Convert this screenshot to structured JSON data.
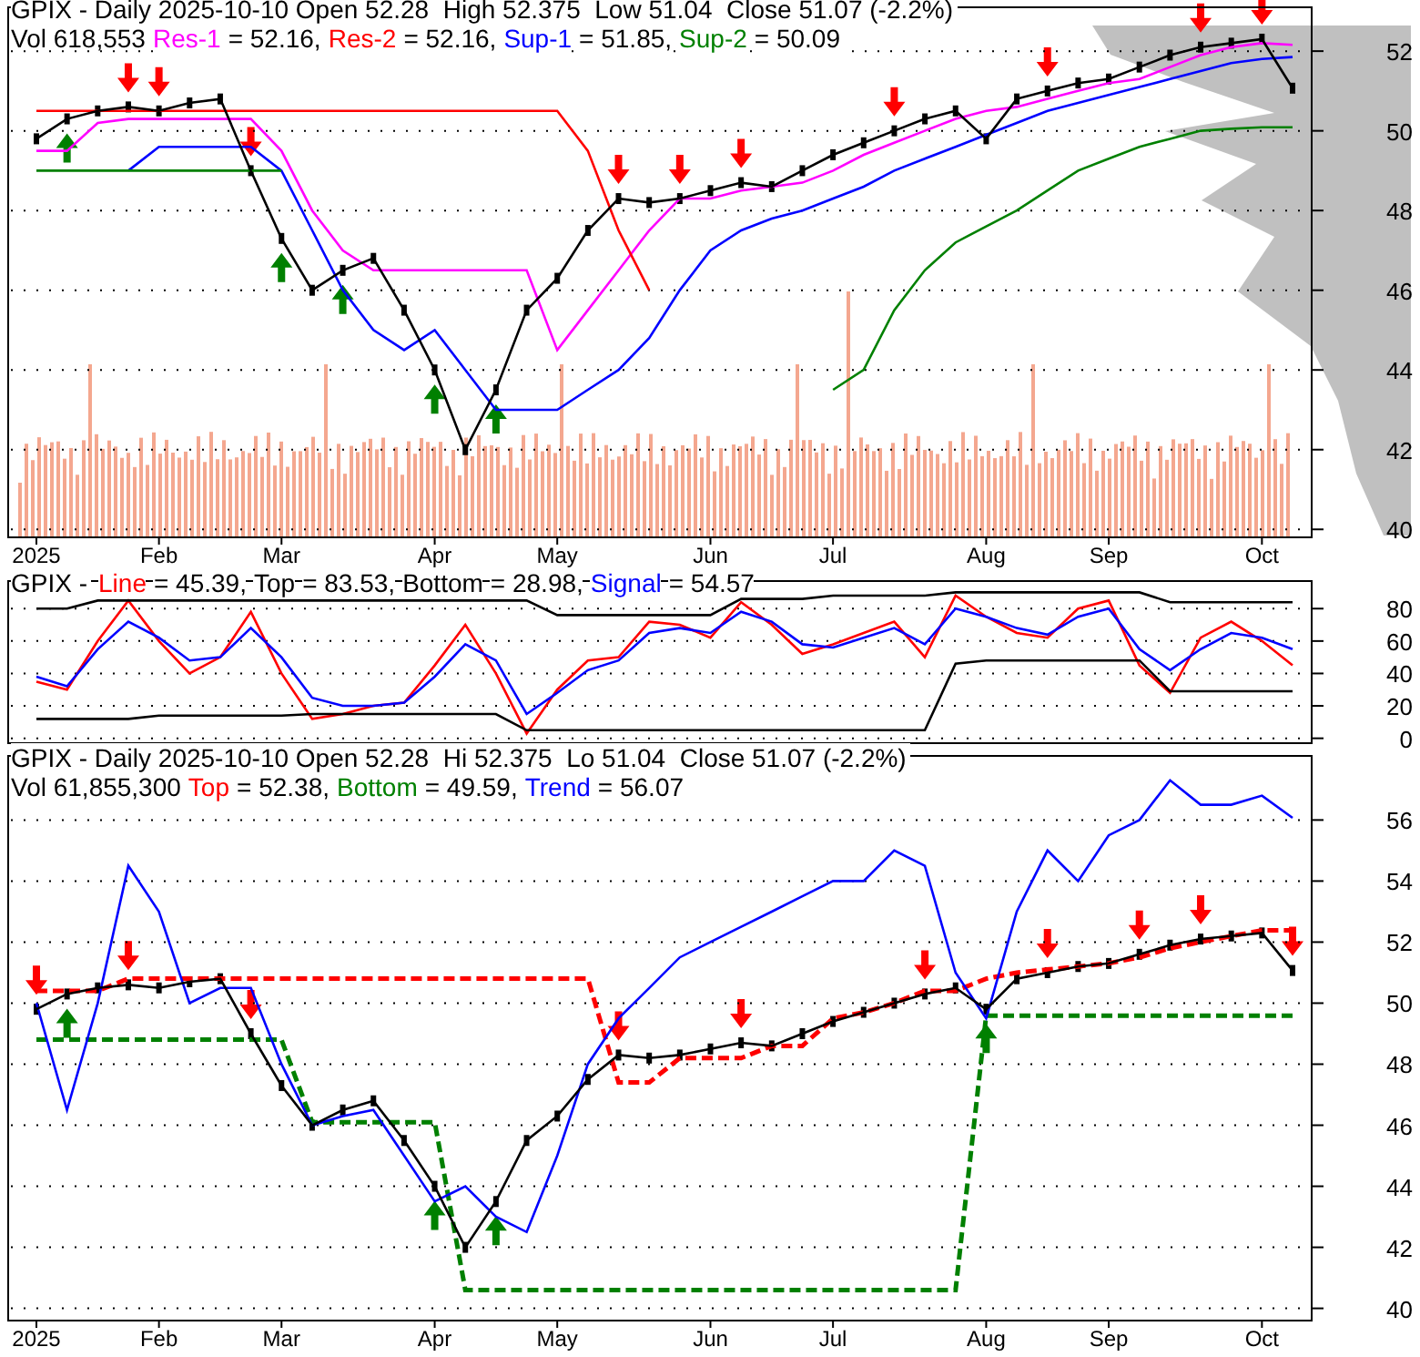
{
  "price_panel": {
    "header": "GPIX - Daily 2025-10-10 Open 52.28  High 52.375  Low 51.04  Close 51.07 (-2.2%)",
    "volume": "Vol 618,553",
    "legend": [
      {
        "value": "= 52.16,"
      },
      {
        "value": "= 52.16,"
      },
      {
        "value": "= 51.85,"
      },
      {
        "value": "= 50.09"
      }
    ],
    "chart_data": {
      "type": "line",
      "grid": true,
      "categories": [
        "2025",
        null,
        null,
        null,
        "Feb",
        null,
        null,
        null,
        "Mar",
        null,
        null,
        null,
        null,
        "Apr",
        null,
        null,
        null,
        "May",
        null,
        null,
        null,
        null,
        "Jun",
        null,
        null,
        null,
        "Jul",
        null,
        null,
        null,
        null,
        "Aug",
        null,
        null,
        null,
        "Sep",
        null,
        null,
        null,
        null,
        "Oct",
        null
      ],
      "ylim": [
        39.8,
        53.1
      ],
      "yticks": [
        40,
        42,
        44,
        46,
        48,
        50,
        52
      ],
      "series": [
        {
          "name": "Res-1",
          "color": "#ff00ff",
          "values": [
            49.5,
            49.5,
            50.2,
            50.3,
            50.3,
            50.3,
            50.3,
            50.3,
            49.5,
            48,
            47,
            46.5,
            46.5,
            46.5,
            46.5,
            46.5,
            46.5,
            44.5,
            45.5,
            46.5,
            47.5,
            48.3,
            48.3,
            48.5,
            48.6,
            48.7,
            49,
            49.4,
            49.7,
            50,
            50.3,
            50.5,
            50.6,
            50.8,
            51,
            51.2,
            51.3,
            51.6,
            51.9,
            52.1,
            52.2,
            52.16
          ]
        },
        {
          "name": "Res-2",
          "color": "#ff0000",
          "values": [
            50.5,
            50.5,
            50.5,
            50.5,
            50.5,
            50.5,
            50.5,
            50.5,
            50.5,
            50.5,
            50.5,
            50.5,
            50.5,
            50.5,
            50.5,
            50.5,
            50.5,
            50.5,
            49.5,
            47.5,
            46,
            null,
            null,
            null,
            null,
            null,
            null,
            null,
            null,
            null,
            null,
            null,
            null,
            null,
            null,
            null,
            null,
            null,
            null,
            null,
            null,
            null
          ]
        },
        {
          "name": "Sup-1",
          "color": "#0000ff",
          "values": [
            null,
            null,
            null,
            49,
            49.6,
            49.6,
            49.6,
            49.6,
            49,
            47.5,
            46,
            45,
            44.5,
            45,
            44,
            43,
            43,
            43,
            43.5,
            44,
            44.8,
            46,
            47,
            47.5,
            47.8,
            48,
            48.3,
            48.6,
            49,
            49.3,
            49.6,
            49.9,
            50.2,
            50.5,
            50.7,
            50.9,
            51.1,
            51.3,
            51.5,
            51.7,
            51.8,
            51.85
          ]
        },
        {
          "name": "Sup-2",
          "color": "#008000",
          "values": [
            49,
            49,
            49,
            49,
            49,
            49,
            49,
            49,
            49,
            null,
            null,
            null,
            null,
            null,
            null,
            null,
            null,
            null,
            null,
            null,
            null,
            null,
            null,
            null,
            null,
            null,
            43.5,
            44,
            45.5,
            46.5,
            47.2,
            47.6,
            48,
            48.5,
            49,
            49.3,
            49.6,
            49.8,
            50,
            50.05,
            50.09,
            50.09
          ]
        },
        {
          "color": "#000000",
          "values": [
            49.8,
            50.3,
            50.5,
            50.6,
            50.5,
            50.7,
            50.8,
            49,
            47.3,
            46,
            46.5,
            46.8,
            45.5,
            44,
            42,
            43.5,
            45.5,
            46.3,
            47.5,
            48.3,
            48.2,
            48.3,
            48.5,
            48.7,
            48.6,
            49,
            49.4,
            49.7,
            50,
            50.3,
            50.5,
            49.8,
            50.8,
            51,
            51.2,
            51.3,
            51.6,
            51.9,
            52.1,
            52.2,
            52.3,
            51.07
          ]
        }
      ]
    }
  },
  "oscillator_panel": {
    "header": "GPIX -",
    "legend": [
      {
        "value": "= 45.39,"
      },
      {
        "value": "= 83.53,"
      },
      {
        "value": "= 28.98,"
      },
      {
        "value": "= 54.57"
      }
    ],
    "chart_data": {
      "type": "line",
      "grid": true,
      "ylim": [
        -3,
        97
      ],
      "yticks": [
        0,
        20,
        40,
        60,
        80
      ],
      "series": [
        {
          "name": "Line",
          "color": "#ff0000",
          "values": [
            35,
            30,
            60,
            85,
            60,
            40,
            50,
            78,
            40,
            12,
            15,
            20,
            22,
            45,
            70,
            40,
            3,
            30,
            48,
            50,
            72,
            70,
            62,
            84,
            70,
            52,
            58,
            65,
            72,
            50,
            88,
            75,
            65,
            62,
            80,
            85,
            45,
            28,
            62,
            72,
            60,
            45
          ]
        },
        {
          "name": "Top",
          "color": "#000000",
          "values": [
            80,
            80,
            85,
            85,
            85,
            85,
            85,
            85,
            85,
            85,
            85,
            85,
            85,
            85,
            85,
            85,
            85,
            76,
            76,
            76,
            76,
            76,
            76,
            86,
            86,
            86,
            88,
            88,
            88,
            88,
            90,
            90,
            90,
            90,
            90,
            90,
            90,
            84,
            84,
            84,
            84,
            84
          ]
        },
        {
          "name": "Bottom",
          "color": "#000000",
          "values": [
            12,
            12,
            12,
            12,
            14,
            14,
            14,
            14,
            14,
            15,
            15,
            15,
            15,
            15,
            15,
            15,
            5,
            5,
            5,
            5,
            5,
            5,
            5,
            5,
            5,
            5,
            5,
            5,
            5,
            5,
            46,
            48,
            48,
            48,
            48,
            48,
            48,
            29,
            29,
            29,
            29,
            29
          ]
        },
        {
          "name": "Signal",
          "color": "#0000ff",
          "values": [
            38,
            32,
            55,
            72,
            62,
            48,
            50,
            68,
            50,
            25,
            20,
            20,
            22,
            38,
            58,
            48,
            15,
            28,
            42,
            48,
            65,
            68,
            65,
            78,
            72,
            58,
            56,
            62,
            68,
            58,
            80,
            75,
            68,
            64,
            75,
            80,
            55,
            42,
            55,
            65,
            62,
            55
          ]
        }
      ]
    }
  },
  "trend_panel": {
    "header": "GPIX - Daily 2025-10-10 Open 52.28  Hi 52.375  Lo 51.04  Close 51.07 (-2.2%)",
    "volume": "Vol 61,855,300",
    "legend": [
      {
        "value": "= 52.38,"
      },
      {
        "value": "= 49.59,"
      },
      {
        "value": "= 56.07"
      }
    ],
    "chart_data": {
      "type": "line",
      "grid": true,
      "categories": [
        "2025",
        null,
        null,
        null,
        "Feb",
        null,
        null,
        null,
        "Mar",
        null,
        null,
        null,
        null,
        "Apr",
        null,
        null,
        null,
        "May",
        null,
        null,
        null,
        null,
        "Jun",
        null,
        null,
        null,
        "Jul",
        null,
        null,
        null,
        null,
        "Aug",
        null,
        null,
        null,
        "Sep",
        null,
        null,
        null,
        null,
        "Oct",
        null
      ],
      "ylim": [
        39.6,
        58.1
      ],
      "yticks": [
        40,
        42,
        44,
        46,
        48,
        50,
        52,
        54,
        56
      ],
      "series": [
        {
          "name": "Top",
          "color": "#ff0000",
          "line_style": "dashed",
          "values": [
            50.4,
            50.4,
            50.4,
            50.8,
            50.8,
            50.8,
            50.8,
            50.8,
            50.8,
            50.8,
            50.8,
            50.8,
            50.8,
            50.8,
            50.8,
            50.8,
            50.8,
            50.8,
            50.8,
            47.4,
            47.4,
            48.2,
            48.2,
            48.2,
            48.6,
            48.6,
            49.5,
            49.7,
            50,
            50.4,
            50.4,
            50.8,
            51,
            51.1,
            51.2,
            51.3,
            51.5,
            51.8,
            52,
            52.2,
            52.38,
            52.38
          ]
        },
        {
          "name": "Bottom",
          "color": "#008000",
          "line_style": "dashed",
          "values": [
            48.8,
            48.8,
            48.8,
            48.8,
            48.8,
            48.8,
            48.8,
            48.8,
            48.8,
            46.1,
            46.1,
            46.1,
            46.1,
            46.1,
            40.6,
            40.6,
            40.6,
            40.6,
            40.6,
            40.6,
            40.6,
            40.6,
            40.6,
            40.6,
            40.6,
            40.6,
            40.6,
            40.6,
            40.6,
            40.6,
            40.6,
            49.59,
            49.59,
            49.59,
            49.59,
            49.59,
            49.59,
            49.59,
            49.59,
            49.59,
            49.59,
            49.59
          ]
        },
        {
          "name": "Trend",
          "color": "#0000ff",
          "values": [
            50,
            46.5,
            50,
            54.5,
            53,
            50,
            50.5,
            50.5,
            48,
            46,
            46.3,
            46.5,
            45,
            43.5,
            44,
            43,
            42.5,
            45,
            48,
            49.5,
            50.5,
            51.5,
            52,
            52.5,
            53,
            53.5,
            54,
            54,
            55,
            54.5,
            51,
            49.5,
            53,
            55,
            54,
            55.5,
            56,
            57.3,
            56.5,
            56.5,
            56.8,
            56.07
          ]
        },
        {
          "color": "#000000",
          "values": [
            49.8,
            50.3,
            50.5,
            50.6,
            50.5,
            50.7,
            50.8,
            49,
            47.3,
            46,
            46.5,
            46.8,
            45.5,
            44,
            42,
            43.5,
            45.5,
            46.3,
            47.5,
            48.3,
            48.2,
            48.3,
            48.5,
            48.7,
            48.6,
            49,
            49.4,
            49.7,
            50,
            50.3,
            50.5,
            49.8,
            50.8,
            51,
            51.2,
            51.3,
            51.6,
            51.9,
            52.1,
            52.2,
            52.3,
            51.07
          ]
        }
      ]
    }
  }
}
